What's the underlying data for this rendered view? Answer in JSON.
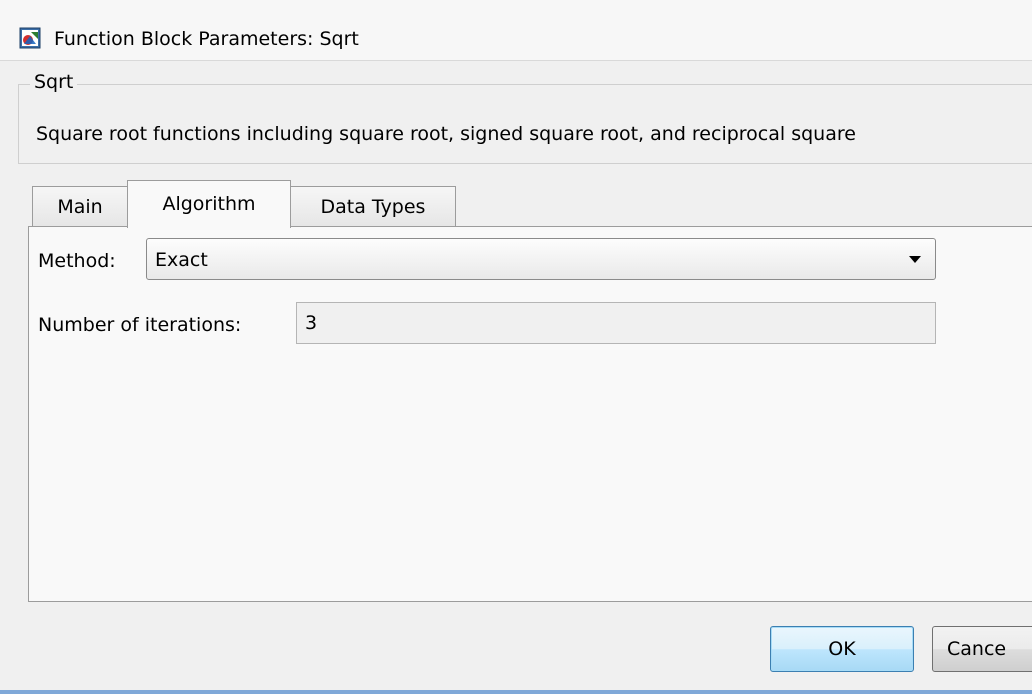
{
  "window": {
    "title": "Function Block Parameters: Sqrt",
    "icon": "simulink-block-icon"
  },
  "group": {
    "legend": "Sqrt",
    "description": "Square root functions including square root, signed square root, and reciprocal square"
  },
  "tabs": [
    {
      "label": "Main",
      "active": false
    },
    {
      "label": "Algorithm",
      "active": true
    },
    {
      "label": "Data Types",
      "active": false
    }
  ],
  "algorithm": {
    "method_label": "Method:",
    "method_value": "Exact",
    "iterations_label": "Number of iterations:",
    "iterations_value": "3"
  },
  "buttons": {
    "ok": "OK",
    "cancel": "Cance"
  },
  "colors": {
    "dialog_bg": "#f0f0f0",
    "default_button_border": "#3c7fb1"
  }
}
